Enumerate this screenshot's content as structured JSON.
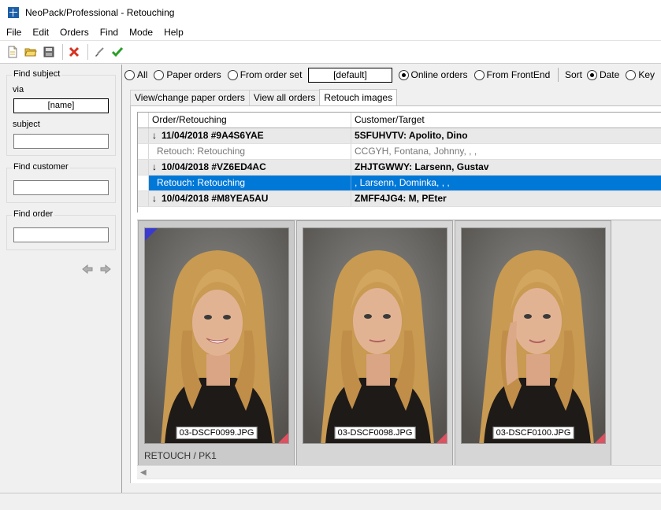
{
  "window": {
    "title": "NeoPack/Professional - Retouching"
  },
  "menu": [
    "File",
    "Edit",
    "Orders",
    "Find",
    "Mode",
    "Help"
  ],
  "toolbar": {
    "buttons": [
      {
        "name": "new-icon"
      },
      {
        "name": "open-folder-icon"
      },
      {
        "name": "save-icon"
      },
      {
        "name": "delete-icon"
      },
      {
        "name": "brush-icon"
      },
      {
        "name": "check-icon"
      }
    ]
  },
  "left_panel": {
    "find_subject": {
      "title": "Find subject",
      "via_label": "via",
      "via_value": "[name]",
      "subject_label": "subject",
      "subject_value": ""
    },
    "find_customer": {
      "title": "Find customer",
      "value": ""
    },
    "find_order": {
      "title": "Find order",
      "value": ""
    }
  },
  "filter": {
    "all": "All",
    "paper_orders": "Paper orders",
    "from_order_set": "From order set",
    "order_set_value": "[default]",
    "online_orders": "Online orders",
    "from_frontend": "From FrontEnd",
    "sort_label": "Sort",
    "sort_date": "Date",
    "sort_key": "Key",
    "selected_source": "online_orders",
    "selected_sort": "date"
  },
  "tabs": [
    {
      "label": "View/change paper orders",
      "active": false
    },
    {
      "label": "View all orders",
      "active": false
    },
    {
      "label": "Retouch images",
      "active": true
    }
  ],
  "grid": {
    "columns": [
      "Order/Retouching",
      "Customer/Target"
    ],
    "rows": [
      {
        "type": "order",
        "order": "11/04/2018 #9A4S6YAE",
        "customer": "5SFUHVTV: Apolito, Dino"
      },
      {
        "type": "retouch",
        "order": "Retouch: Retouching",
        "customer": "CCGYH, Fontana, Johnny, , ,"
      },
      {
        "type": "order",
        "order": "10/04/2018 #VZ6ED4AC",
        "customer": "ZHJTGWWY: Larsenn, Gustav"
      },
      {
        "type": "selected",
        "order": "Retouch: Retouching",
        "customer": ", Larsenn, Dominka, , ,"
      },
      {
        "type": "order",
        "order": "10/04/2018 #M8YEA5AU",
        "customer": "ZMFF4JG4: M, PEter"
      }
    ]
  },
  "thumbnails": [
    {
      "filename": "03-DSCF0099.JPG",
      "caption": "RETOUCH / PK1",
      "selected": true,
      "pose": "smile"
    },
    {
      "filename": "03-DSCF0098.JPG",
      "caption": "",
      "selected": false,
      "pose": "neutral"
    },
    {
      "filename": "03-DSCF0100.JPG",
      "caption": "",
      "selected": false,
      "pose": "hand"
    }
  ],
  "colors": {
    "selection": "#0078d7",
    "accent_red": "#e05060",
    "corner_blue": "#3a3ad0"
  }
}
